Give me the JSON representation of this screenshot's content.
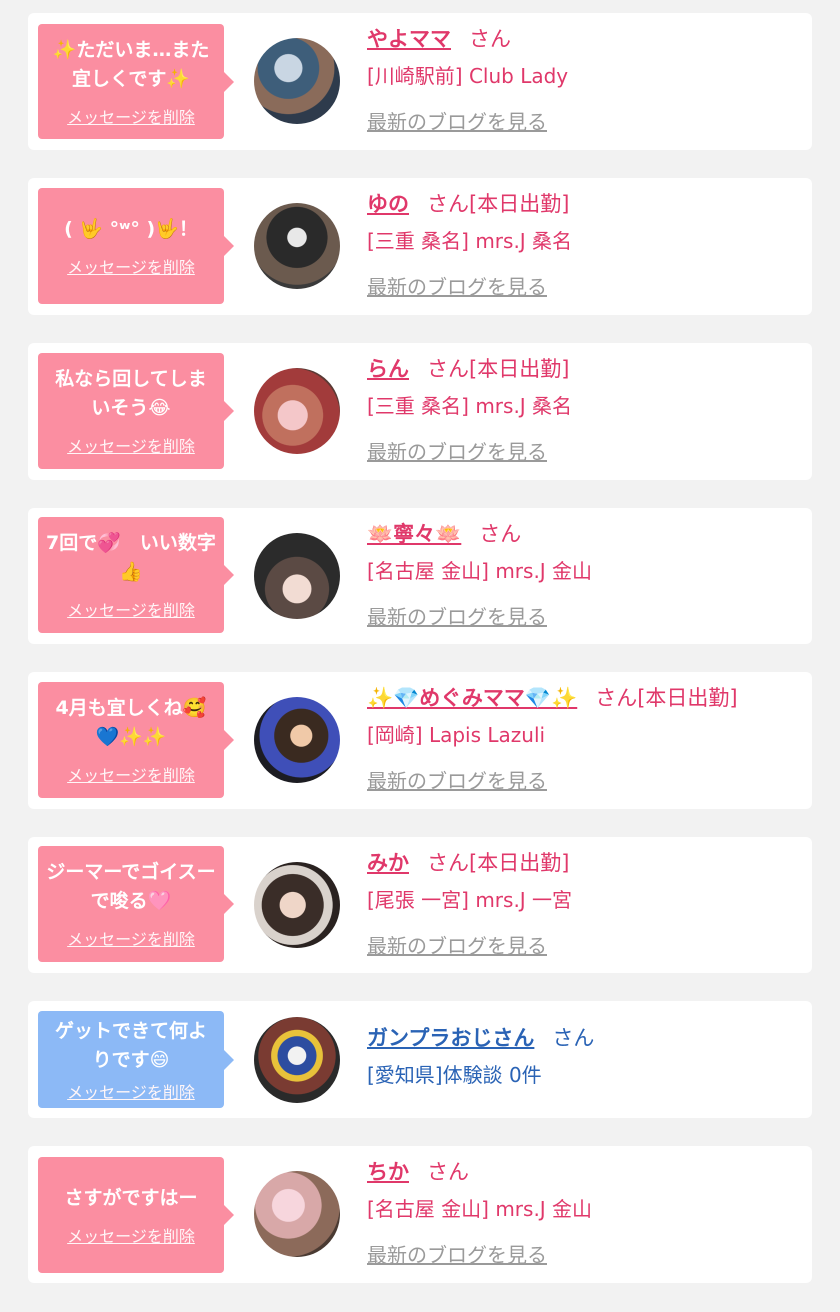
{
  "items": [
    {
      "message": "✨ただいま…また宜しくです✨",
      "delete_label": "メッセージを削除",
      "name": "やよママ",
      "suffix": "さん",
      "shop": "[川崎駅前] Club Lady",
      "blog_link": "最新のブログを見る",
      "theme": "pink"
    },
    {
      "message": "( 🤟 °ʷ° )🤟！",
      "delete_label": "メッセージを削除",
      "name": "ゆの",
      "suffix": "さん[本日出勤]",
      "shop": "[三重 桑名] mrs.J 桑名",
      "blog_link": "最新のブログを見る",
      "theme": "pink"
    },
    {
      "message": "私なら回してしまいそう😂",
      "delete_label": "メッセージを削除",
      "name": "らん",
      "suffix": "さん[本日出勤]",
      "shop": "[三重 桑名] mrs.J 桑名",
      "blog_link": "最新のブログを見る",
      "theme": "pink"
    },
    {
      "message": "7回で💞　いい数字👍",
      "delete_label": "メッセージを削除",
      "name": "🪷寧々🪷",
      "suffix": "さん",
      "shop": "[名古屋 金山] mrs.J 金山",
      "blog_link": "最新のブログを見る",
      "theme": "pink"
    },
    {
      "message": "4月も宜しくね🥰💙✨✨",
      "delete_label": "メッセージを削除",
      "name": "✨💎めぐみママ💎✨",
      "suffix": "さん[本日出勤]",
      "shop": "[岡崎] Lapis Lazuli",
      "blog_link": "最新のブログを見る",
      "theme": "pink"
    },
    {
      "message": "ジーマーでゴイスーで唆る🩷",
      "delete_label": "メッセージを削除",
      "name": "みか",
      "suffix": "さん[本日出勤]",
      "shop": "[尾張 一宮] mrs.J 一宮",
      "blog_link": "最新のブログを見る",
      "theme": "pink"
    },
    {
      "message": "ゲットできて何よりです😄",
      "delete_label": "メッセージを削除",
      "name": "ガンプラおじさん",
      "suffix": "さん",
      "shop": "[愛知県]体験談 0件",
      "blog_link": "",
      "theme": "blue"
    },
    {
      "message": "さすがですはー",
      "delete_label": "メッセージを削除",
      "name": "ちか",
      "suffix": "さん",
      "shop": "[名古屋 金山] mrs.J 金山",
      "blog_link": "最新のブログを見る",
      "theme": "pink"
    }
  ],
  "colors": {
    "pink_bubble": "#fb8ea1",
    "blue_bubble": "#8cb9f6",
    "pink_text": "#e0386a",
    "blue_text": "#2a63b5",
    "muted_link": "#9a9a9a"
  }
}
